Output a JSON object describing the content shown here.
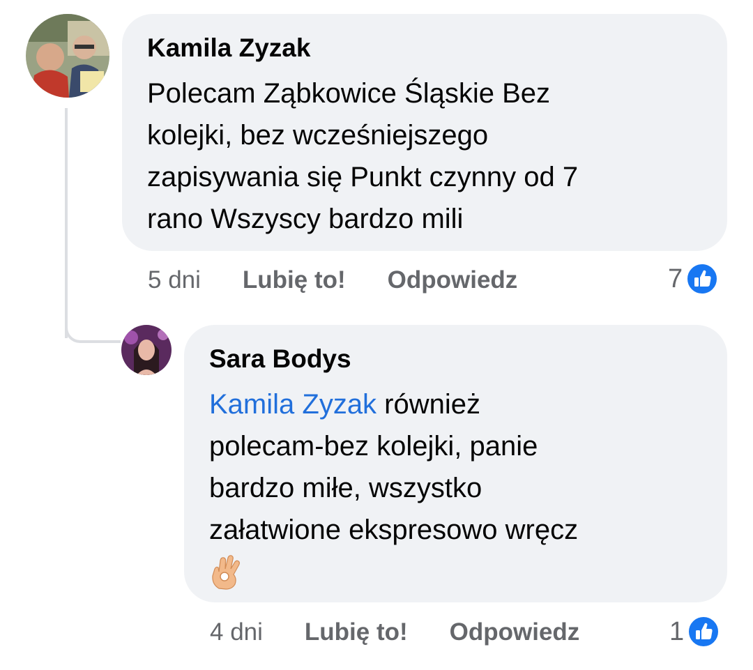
{
  "comments": [
    {
      "author": "Kamila Zyzak",
      "text_lines": [
        "Polecam Ząbkowice Śląskie Bez",
        "kolejki, bez wcześniejszego",
        "zapisywania się Punkt czynny od 7",
        "rano Wszyscy bardzo mili"
      ],
      "time": "5 dni",
      "like_label": "Lubię to!",
      "reply_label": "Odpowiedz",
      "reaction_count": "7",
      "reaction_icon": "thumbs-up-icon"
    },
    {
      "author": "Sara Bodys",
      "mention": "Kamila Zyzak",
      "text_lines": [
        " również",
        "polecam-bez kolejki, panie",
        "bardzo miłe, wszystko",
        "załatwione ekspresowo wręcz"
      ],
      "emoji": "ok-hand-emoji",
      "time": "4 dni",
      "like_label": "Lubię to!",
      "reply_label": "Odpowiedz",
      "reaction_count": "1",
      "reaction_icon": "thumbs-up-icon"
    }
  ],
  "colors": {
    "bubble": "#f0f2f5",
    "mention": "#216fdb",
    "meta": "#65676b",
    "like_blue": "#1877f2"
  }
}
